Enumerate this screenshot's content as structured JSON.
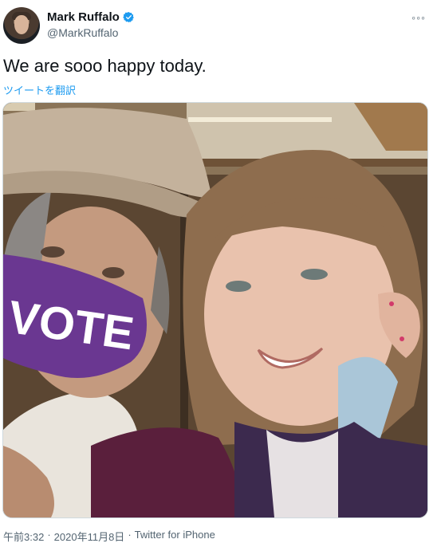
{
  "author": {
    "display_name": "Mark Ruffalo",
    "handle": "@MarkRuffalo",
    "verified": true
  },
  "tweet": {
    "text": "We are sooo happy today.",
    "translate_label": "ツイートを翻訳",
    "mask_text": "VOTE"
  },
  "meta": {
    "time": "午前3:32",
    "separator": "·",
    "date": "2020年11月8日",
    "separator2": "·",
    "source": "Twitter for iPhone"
  },
  "icons": {
    "more": "more-options-icon",
    "verified": "verified-badge-icon"
  },
  "colors": {
    "link": "#1d9bf0",
    "verified": "#1d9bf0",
    "secondary_text": "#536471",
    "mask": "#6a3791"
  }
}
